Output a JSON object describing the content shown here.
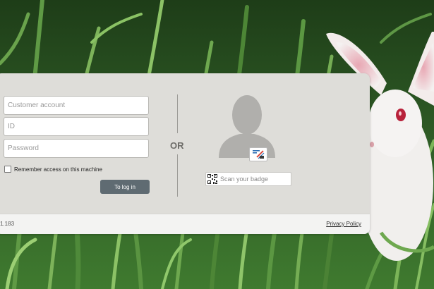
{
  "login_form": {
    "customer_account_placeholder": "Customer account",
    "id_placeholder": "ID",
    "password_placeholder": "Password",
    "remember_label": "Remember access on this machine",
    "login_button": "To log in"
  },
  "alternative": {
    "or_label": "OR",
    "scan_badge_placeholder": "Scan your badge"
  },
  "footer": {
    "version": "1.183",
    "privacy_policy": "Privacy Policy"
  },
  "icons": {
    "avatar": "user-silhouette-icon",
    "badge": "badge-scan-icon",
    "qr": "qr-code-icon"
  },
  "colors": {
    "card": "#deddd9",
    "footer": "#f3f3f2",
    "login_button": "#5f6b72",
    "avatar": "#b0afac"
  }
}
